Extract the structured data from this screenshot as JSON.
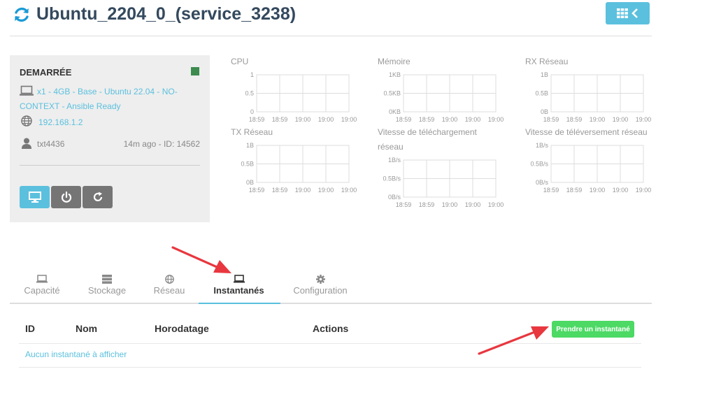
{
  "header": {
    "title": "Ubuntu_2204_0_(service_3238)",
    "refresh_icon": "refresh-icon",
    "grid_button_icons": [
      "grid-icon",
      "chevron-left-icon"
    ]
  },
  "vm": {
    "status": "DEMARRÉE",
    "status_color": "#3d8b4f",
    "specs": "x1 - 4GB - Base - Ubuntu 22.04 - NO-CONTEXT - Ansible Ready",
    "ip": "192.168.1.2",
    "user": "txt4436",
    "created": "14m ago - ID: 14562",
    "buttons": [
      "monitor-icon",
      "power-icon",
      "refresh-icon"
    ]
  },
  "charts": [
    {
      "title": "CPU",
      "y_ticks": [
        "1",
        "0.5",
        "0"
      ],
      "x_ticks": [
        "18:59",
        "18:59",
        "19:00",
        "19:00",
        "19:00"
      ]
    },
    {
      "title": "Mémoire",
      "y_ticks": [
        "1KB",
        "0.5KB",
        "0KB"
      ],
      "x_ticks": [
        "18:59",
        "18:59",
        "19:00",
        "19:00",
        "19:00"
      ]
    },
    {
      "title": "RX Réseau",
      "y_ticks": [
        "1B",
        "0.5B",
        "0B"
      ],
      "x_ticks": [
        "18:59",
        "18:59",
        "19:00",
        "19:00",
        "19:00"
      ]
    },
    {
      "title": "TX Réseau",
      "y_ticks": [
        "1B",
        "0.5B",
        "0B"
      ],
      "x_ticks": [
        "18:59",
        "18:59",
        "19:00",
        "19:00",
        "19:00"
      ]
    },
    {
      "title": "Vitesse de téléchargement réseau",
      "y_ticks": [
        "1B/s",
        "0.5B/s",
        "0B/s"
      ],
      "x_ticks": [
        "18:59",
        "18:59",
        "19:00",
        "19:00",
        "19:00"
      ]
    },
    {
      "title": "Vitesse de téléversement réseau",
      "y_ticks": [
        "1B/s",
        "0.5B/s",
        "0B/s"
      ],
      "x_ticks": [
        "18:59",
        "18:59",
        "19:00",
        "19:00",
        "19:00"
      ]
    }
  ],
  "tabs": [
    {
      "label": "Capacité",
      "icon": "laptop-icon",
      "active": false
    },
    {
      "label": "Stockage",
      "icon": "storage-icon",
      "active": false
    },
    {
      "label": "Réseau",
      "icon": "globe-icon",
      "active": false
    },
    {
      "label": "Instantanés",
      "icon": "laptop-icon",
      "active": true
    },
    {
      "label": "Configuration",
      "icon": "gear-icon",
      "active": false
    }
  ],
  "snapshots": {
    "columns": [
      "ID",
      "Nom",
      "Horodatage",
      "Actions"
    ],
    "take_snapshot_label": "Prendre un instantané",
    "empty_message": "Aucun instantané à afficher"
  },
  "colors": {
    "accent": "#5bc0de",
    "title": "#34495e",
    "success": "#4cd964",
    "annotation_arrow": "#e8373f"
  }
}
